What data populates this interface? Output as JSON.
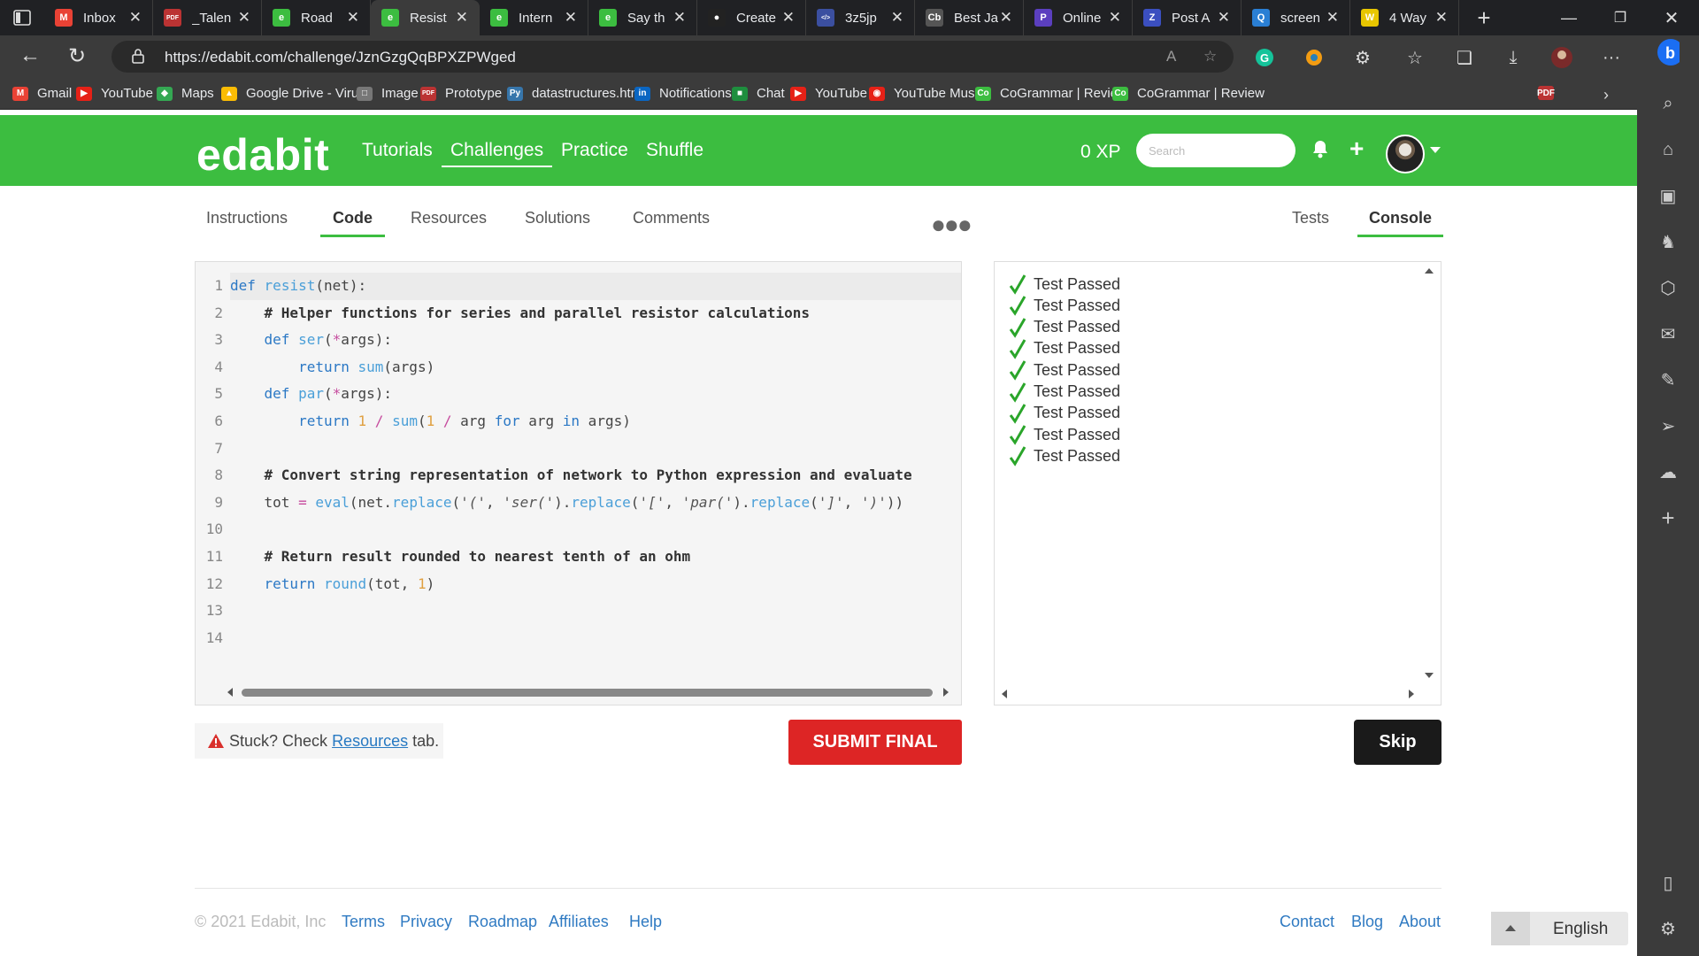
{
  "browser": {
    "tabs": [
      {
        "label": "Inbox",
        "icon": "gmail-icon",
        "color": "#e94235",
        "glyph": "M"
      },
      {
        "label": "_Talen",
        "icon": "pdf-icon",
        "color": "#b33",
        "glyph": "PDF"
      },
      {
        "label": "Road",
        "icon": "edabit-icon",
        "color": "#3cbd40",
        "glyph": "e"
      },
      {
        "label": "Resist",
        "icon": "edabit-icon",
        "color": "#3cbd40",
        "glyph": "e"
      },
      {
        "label": "Intern",
        "icon": "edabit-icon",
        "color": "#3cbd40",
        "glyph": "e"
      },
      {
        "label": "Say th",
        "icon": "edabit-icon",
        "color": "#3cbd40",
        "glyph": "e"
      },
      {
        "label": "Create",
        "icon": "github-icon",
        "color": "#222",
        "glyph": "●"
      },
      {
        "label": "3z5jp",
        "icon": "code-icon",
        "color": "#3b4fa0",
        "glyph": "</>"
      },
      {
        "label": "Best Ja",
        "icon": "cb-icon",
        "color": "#555",
        "glyph": "Cb"
      },
      {
        "label": "Online",
        "icon": "p-icon",
        "color": "#5b3fbf",
        "glyph": "P"
      },
      {
        "label": "Post A",
        "icon": "z-icon",
        "color": "#3b4fc0",
        "glyph": "Z"
      },
      {
        "label": "screen",
        "icon": "search-icon",
        "color": "#2a7fd4",
        "glyph": "Q"
      },
      {
        "label": "4 Way",
        "icon": "w-icon",
        "color": "#e8c600",
        "glyph": "W"
      }
    ],
    "active_tab_index": 3,
    "url": "https://edabit.com/challenge/JznGzgQqBPXZPWged",
    "bookmarks": [
      {
        "label": "Gmail",
        "color": "#e94235",
        "glyph": "M"
      },
      {
        "label": "YouTube",
        "color": "#e62117",
        "glyph": "▶"
      },
      {
        "label": "Maps",
        "color": "#34a853",
        "glyph": "◆"
      },
      {
        "label": "Google Drive - Viru...",
        "color": "#fbbc04",
        "glyph": "▲"
      },
      {
        "label": "Image",
        "color": "#777",
        "glyph": "□"
      },
      {
        "label": "Prototype",
        "color": "#b33",
        "glyph": "PDF"
      },
      {
        "label": "datastructures.html",
        "color": "#3776ab",
        "glyph": "Py"
      },
      {
        "label": "Notifications",
        "color": "#0a66c2",
        "glyph": "in"
      },
      {
        "label": "Chat",
        "color": "#1e8e3e",
        "glyph": "■"
      },
      {
        "label": "YouTube",
        "color": "#e62117",
        "glyph": "▶"
      },
      {
        "label": "YouTube Music",
        "color": "#e62117",
        "glyph": "◉"
      },
      {
        "label": "CoGrammar | Review",
        "color": "#3cbd40",
        "glyph": "Co"
      },
      {
        "label": "CoGrammar | Review",
        "color": "#3cbd40",
        "glyph": "Co"
      }
    ]
  },
  "site": {
    "logo": "edabit",
    "nav": [
      "Tutorials",
      "Challenges",
      "Practice",
      "Shuffle"
    ],
    "xp": "0 XP",
    "search_placeholder": "Search"
  },
  "subtabs_left": [
    "Instructions",
    "Code",
    "Resources",
    "Solutions",
    "Comments"
  ],
  "subtabs_right": [
    "Tests",
    "Console"
  ],
  "editor": {
    "line_numbers": [
      "1",
      "2",
      "3",
      "4",
      "5",
      "6",
      "7",
      "8",
      "9",
      "10",
      "11",
      "12",
      "13",
      "14"
    ],
    "code": [
      "def resist(net):",
      "    # Helper functions for series and parallel resistor calculations",
      "    def ser(*args):",
      "        return sum(args)",
      "    def par(*args):",
      "        return 1 / sum(1 / arg for arg in args)",
      "",
      "    # Convert string representation of network to Python expression and evaluate",
      "    tot = eval(net.replace('(', 'ser(').replace('[', 'par(').replace(']', ')'))",
      "",
      "    # Return result rounded to nearest tenth of an ohm",
      "    return round(tot, 1)",
      "",
      ""
    ]
  },
  "console": {
    "results": [
      "Test Passed",
      "Test Passed",
      "Test Passed",
      "Test Passed",
      "Test Passed",
      "Test Passed",
      "Test Passed",
      "Test Passed",
      "Test Passed"
    ],
    "pass_color": "#2aa52a"
  },
  "stuck": {
    "prefix": "Stuck? Check",
    "link": "Resources",
    "suffix": "tab."
  },
  "buttons": {
    "submit": "SUBMIT FINAL",
    "skip": "Skip"
  },
  "footer": {
    "copyright": "© 2021 Edabit, Inc",
    "left_links": [
      "Terms",
      "Privacy",
      "Roadmap",
      "Affiliates",
      "Help"
    ],
    "right_links": [
      "Contact",
      "Blog",
      "About"
    ],
    "language": "English"
  },
  "colors": {
    "brand_green": "#3cbd40",
    "submit_red": "#dd2525",
    "link_blue": "#2f7ac2"
  }
}
